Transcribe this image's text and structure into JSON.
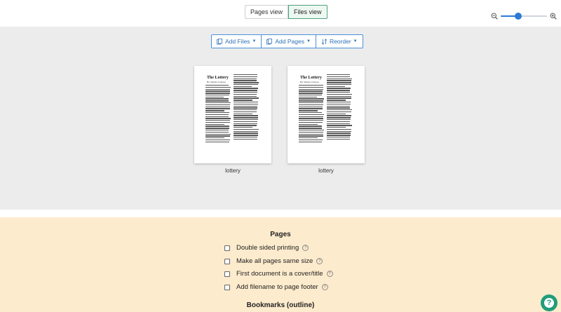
{
  "view_toggle": {
    "pages_view": "Pages view",
    "files_view": "Files view"
  },
  "zoom": {
    "level": 0.35
  },
  "toolbar": {
    "add_files": "Add Files",
    "add_pages": "Add Pages",
    "reorder": "Reorder"
  },
  "files": [
    {
      "name": "lottery",
      "title": "The Lottery",
      "author": "By Shirley Jackson"
    },
    {
      "name": "lottery",
      "title": "The Lottery",
      "author": "By Shirley Jackson"
    }
  ],
  "options": {
    "pages_heading": "Pages",
    "items": [
      {
        "label": "Double sided printing"
      },
      {
        "label": "Make all pages same size"
      },
      {
        "label": "First document is a cover/title"
      },
      {
        "label": "Add filename to page footer"
      }
    ],
    "bookmarks_heading": "Bookmarks (outline)"
  },
  "help": {
    "symbol": "?"
  },
  "colors": {
    "accent": "#2b7bd6",
    "active_toggle": "#4aa37c",
    "panel": "#fdebcd",
    "fab": "#1f9e7a"
  }
}
